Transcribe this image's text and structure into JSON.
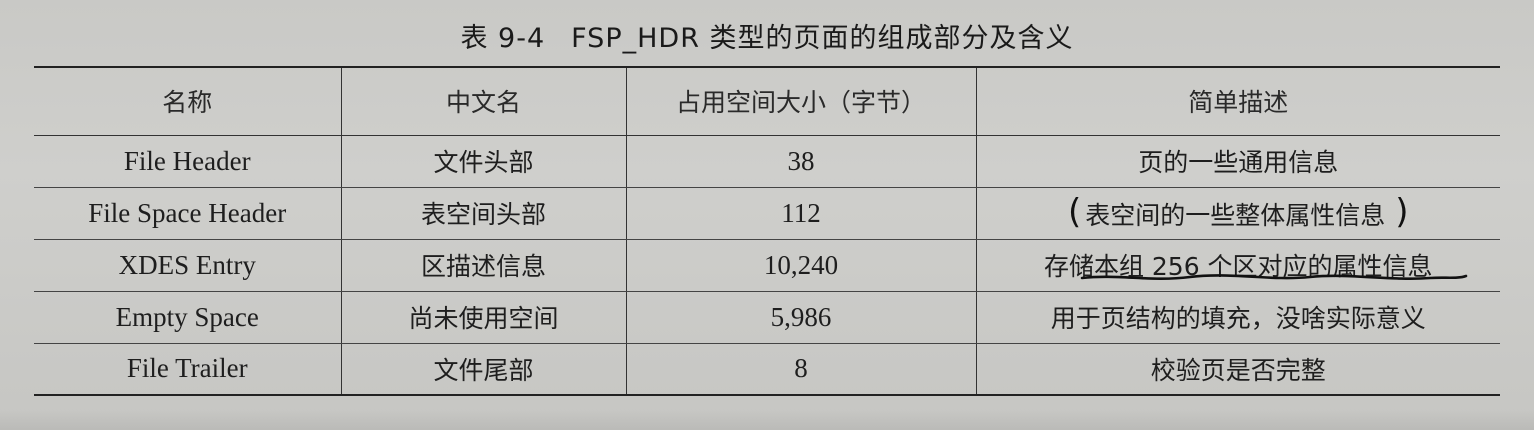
{
  "caption": {
    "number": "表 9-4",
    "title": "FSP_HDR 类型的页面的组成部分及含义"
  },
  "table": {
    "headers": [
      "名称",
      "中文名",
      "占用空间大小（字节）",
      "简单描述"
    ],
    "rows": [
      {
        "name": "File Header",
        "zh_name": "文件头部",
        "size": "38",
        "desc": "页的一些通用信息"
      },
      {
        "name": "File Space Header",
        "zh_name": "表空间头部",
        "size": "112",
        "desc": "表空间的一些整体属性信息"
      },
      {
        "name": "XDES Entry",
        "zh_name": "区描述信息",
        "size": "10,240",
        "desc": "存储本组 256 个区对应的属性信息"
      },
      {
        "name": "Empty Space",
        "zh_name": "尚未使用空间",
        "size": "5,986",
        "desc": "用于页结构的填充，没啥实际意义"
      },
      {
        "name": "File Trailer",
        "zh_name": "文件尾部",
        "size": "8",
        "desc": "校验页是否完整"
      }
    ]
  },
  "annotations": {
    "pen_color": "#111111",
    "bracketed_row": 1,
    "underlined_row": 2
  }
}
